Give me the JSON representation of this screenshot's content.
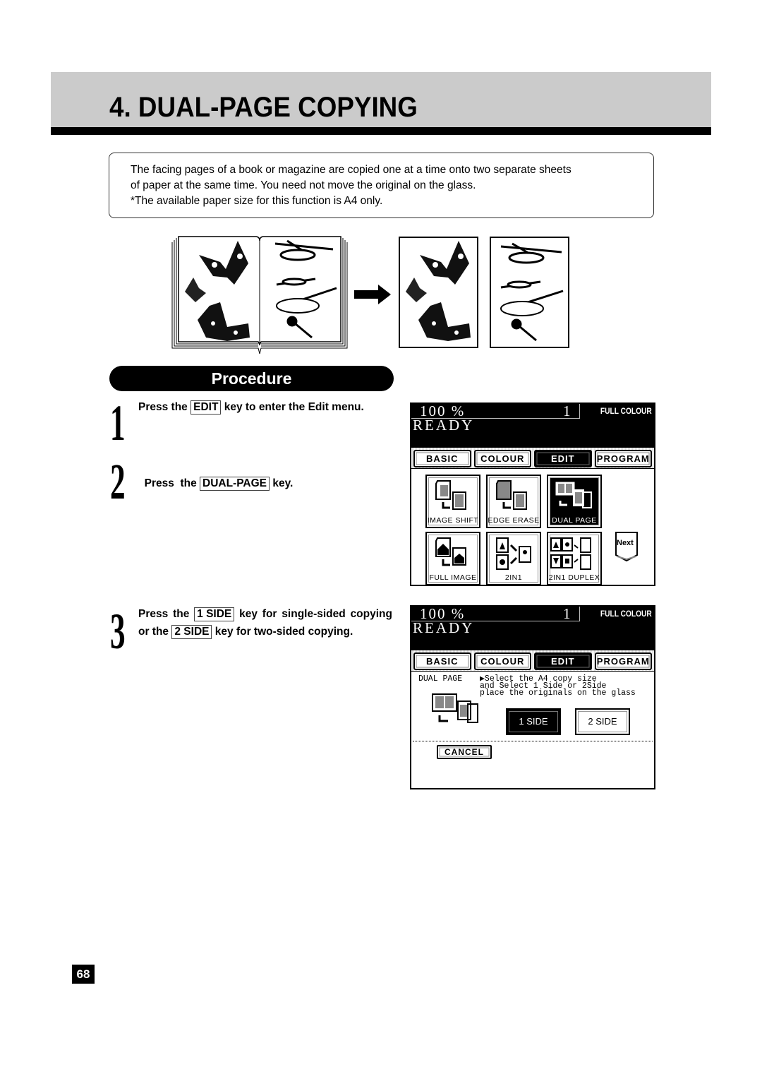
{
  "header": {
    "title": "4. DUAL-PAGE COPYING"
  },
  "intro": {
    "lines": [
      "The facing pages of a book or magazine are copied one at a time onto two separate sheets",
      "of paper at the same time. You need not move the original on the glass.",
      "*The available paper size for this function is A4 only."
    ]
  },
  "illustration": {
    "source": "open-book-icon",
    "arrow": "arrow-right-icon",
    "outputs": [
      "sheet-butterflies",
      "sheet-dragonflies"
    ]
  },
  "procedure": {
    "title": "Procedure",
    "steps": [
      {
        "number": "1",
        "pre": "Press the ",
        "key": "EDIT",
        "post": " key to enter the Edit menu."
      },
      {
        "number": "2",
        "pre": "Press  the ",
        "key": "DUAL-PAGE",
        "post": " key."
      },
      {
        "number": "3",
        "pre": "Press the ",
        "key": "1 SIDE",
        "mid": " key for single-sided copying or the ",
        "key2": "2 SIDE",
        "post": " key for two-sided copying."
      }
    ]
  },
  "screen_common": {
    "zoom": "100 %",
    "copies": "1",
    "color_mode": "FULL COLOUR",
    "status": "READY",
    "tabs": [
      "BASIC",
      "COLOUR",
      "EDIT",
      "PROGRAM"
    ],
    "active_tab": "EDIT"
  },
  "screen1": {
    "functions": [
      {
        "label": "IMAGE SHIFT",
        "active": false
      },
      {
        "label": "EDGE ERASE",
        "active": false
      },
      {
        "label": "DUAL  PAGE",
        "active": true
      },
      {
        "label": "FULL IMAGE",
        "active": false
      },
      {
        "label": "2IN1",
        "active": false
      },
      {
        "label": "2IN1 DUPLEX",
        "active": false
      }
    ],
    "next_label": "Next"
  },
  "screen2": {
    "mode_title": "DUAL PAGE",
    "message": "▶Select the A4 copy size\nand Select 1 Side or 2Side\nplace the originals on the glass",
    "side_options": [
      {
        "label": "1 SIDE",
        "active": true
      },
      {
        "label": "2 SIDE",
        "active": false
      }
    ],
    "cancel_label": "CANCEL"
  },
  "page_number": "68"
}
